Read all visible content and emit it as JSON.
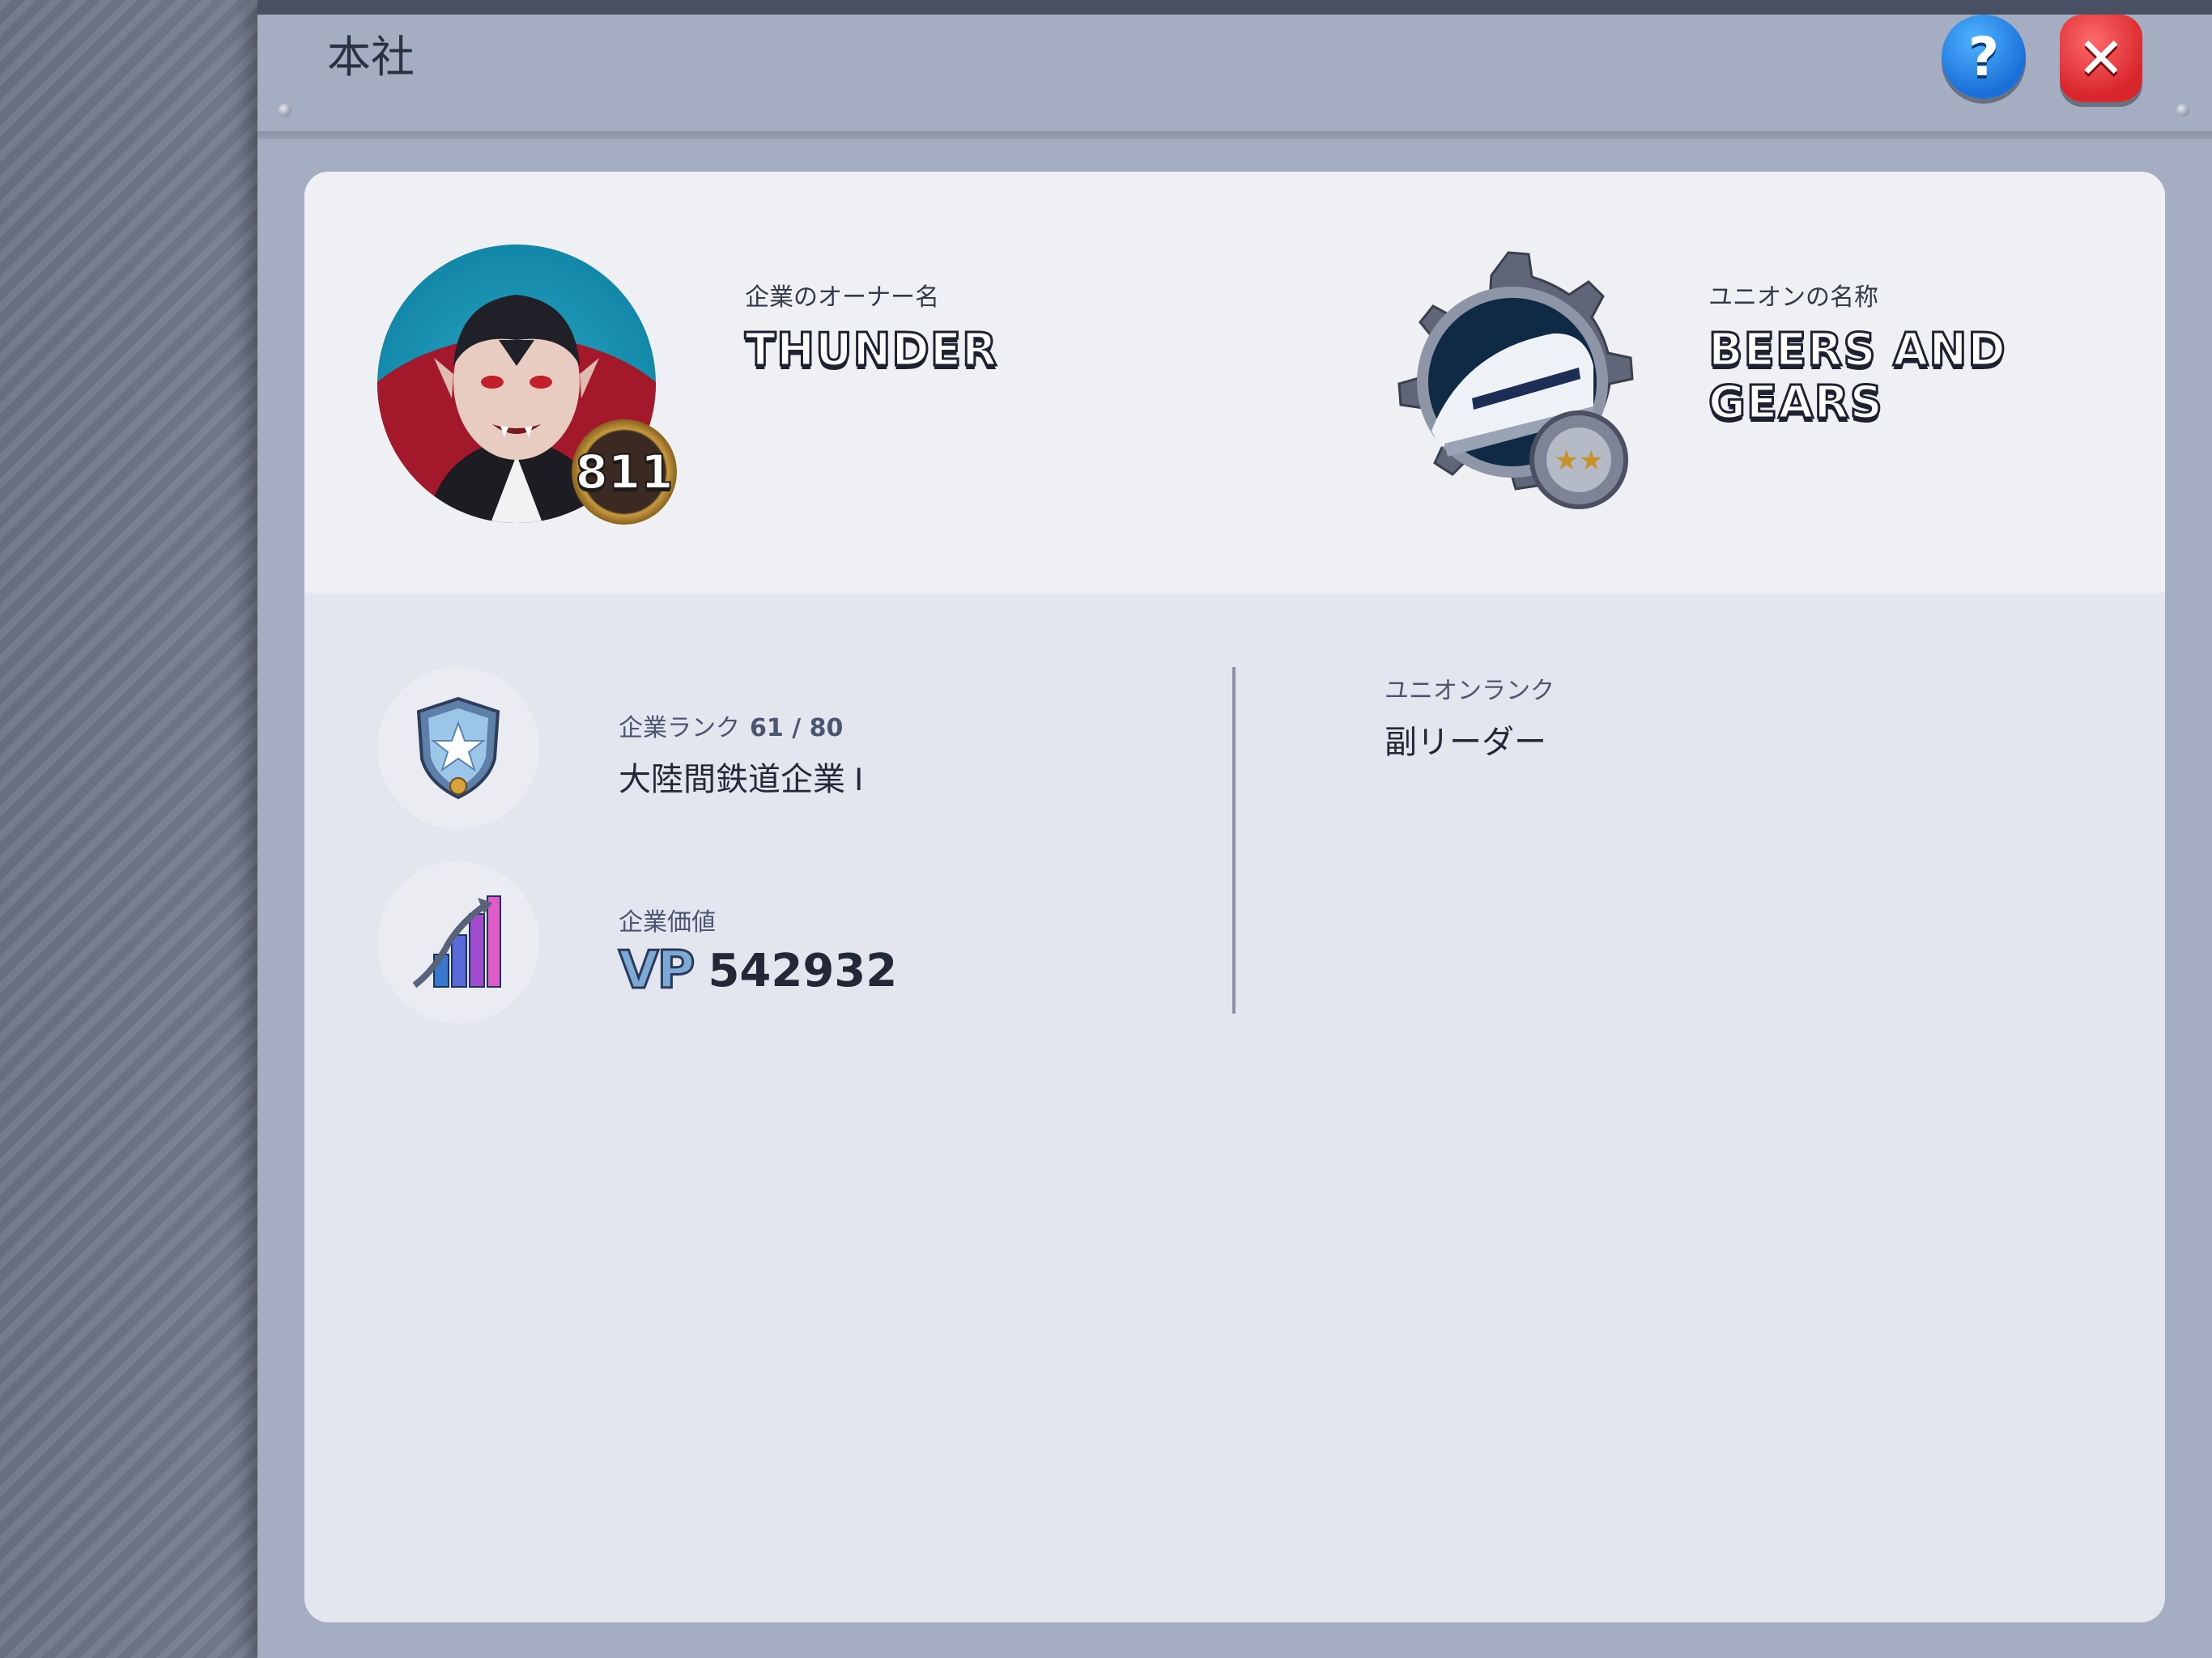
{
  "window": {
    "title": "本社",
    "help_icon": "question-icon",
    "close_icon": "close-icon",
    "help_glyph": "?",
    "close_glyph": "✕"
  },
  "owner": {
    "label": "企業のオーナー名",
    "name": "THUNDER",
    "level": "811",
    "avatar_icon": "vampire-avatar-icon"
  },
  "union": {
    "label": "ユニオンの名称",
    "name": "BEERS AND GEARS",
    "emblem_icon": "train-gear-emblem-icon",
    "rank_label": "ユニオンランク",
    "rank_value": "副リーダー"
  },
  "company": {
    "rank_label": "企業ランク",
    "rank_progress": "61 / 80",
    "rank_name": "大陸間鉄道企業 I",
    "rank_icon": "shield-star-icon",
    "value_label": "企業価値",
    "value_prefix": "VP",
    "value": "542932",
    "value_icon": "growth-chart-icon"
  },
  "colors": {
    "help_button": "#1a6fd8",
    "close_button": "#d8262c",
    "panel": "#a5adc2",
    "card": "#e3e6ef"
  }
}
